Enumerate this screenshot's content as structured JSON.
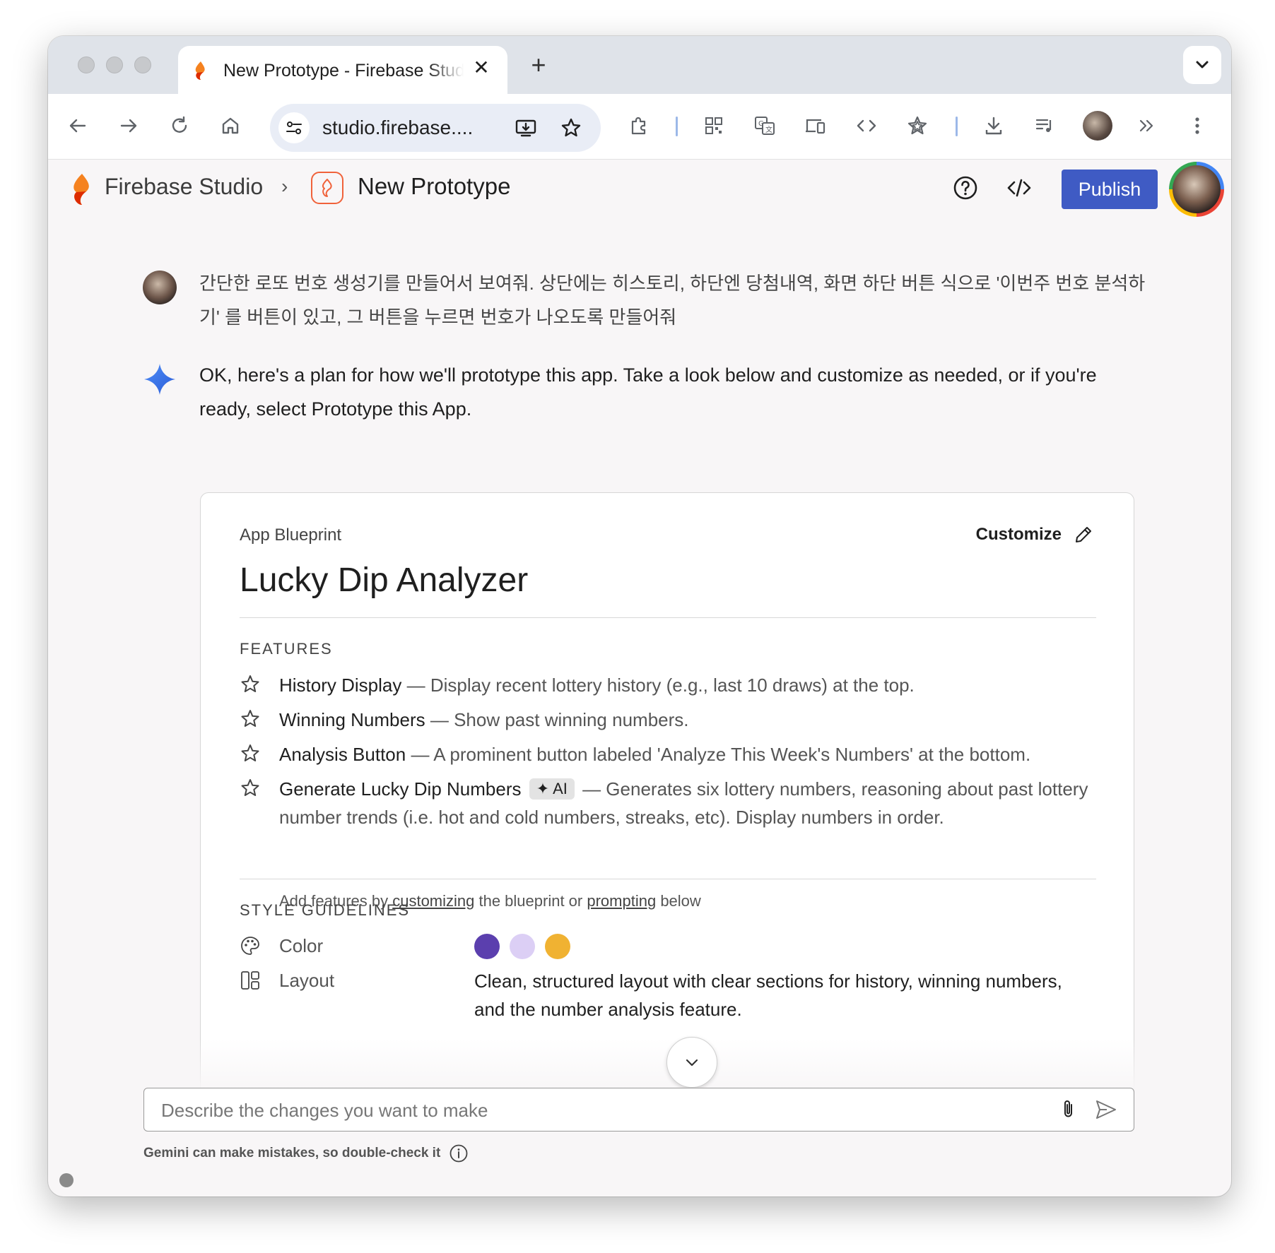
{
  "browser": {
    "tab_title": "New Prototype - Firebase Studio",
    "url": "studio.firebase...."
  },
  "app": {
    "brand": "Firebase Studio",
    "project": "New Prototype",
    "publish_label": "Publish"
  },
  "chat": {
    "user_message": "간단한 로또 번호 생성기를 만들어서 보여줘. 상단에는 히스토리, 하단엔 당첨내역, 화면 하단 버튼 식으로 '이번주 번호 분석하기' 를 버튼이 있고, 그 버튼을 누르면 번호가 나오도록 만들어줘",
    "ai_message": "OK, here's a plan for how we'll prototype this app. Take a look below and customize as needed, or if you're ready, select Prototype this App."
  },
  "blueprint": {
    "label": "App Blueprint",
    "customize_label": "Customize",
    "title": "Lucky Dip Analyzer",
    "features_heading": "FEATURES",
    "features": [
      {
        "name": "History Display",
        "desc": " — Display recent lottery history (e.g., last 10 draws) at the top."
      },
      {
        "name": "Winning Numbers",
        "desc": " — Show past winning numbers."
      },
      {
        "name": "Analysis Button",
        "desc": " — A prominent button labeled 'Analyze This Week's Numbers' at the bottom."
      },
      {
        "name": "Generate Lucky Dip Numbers",
        "badge": "AI",
        "desc": " — Generates six lottery numbers, reasoning about past lottery number trends (i.e. hot and cold numbers, streaks, etc). Display numbers in order."
      }
    ],
    "add_note": {
      "prefix": "Add features by ",
      "link1": "customizing",
      "middle": " the blueprint or ",
      "link2": "prompting",
      "suffix": " below"
    },
    "style_heading": "STYLE GUIDELINES",
    "style": {
      "color_label": "Color",
      "colors": [
        "#5b3fae",
        "#dccff5",
        "#f0b232"
      ],
      "layout_label": "Layout",
      "layout_value": "Clean, structured layout with clear sections for history, winning numbers, and the number analysis feature."
    }
  },
  "input": {
    "placeholder": "Describe the changes you want to make",
    "disclaimer": "Gemini can make mistakes, so double-check it"
  }
}
